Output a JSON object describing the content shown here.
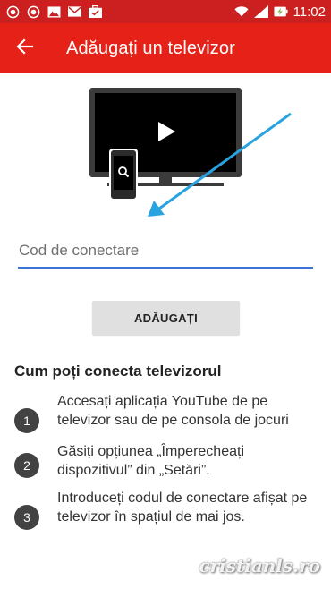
{
  "status_bar": {
    "time": "11:02",
    "icons": [
      "camera-circle-icon",
      "camera-circle-icon",
      "image-icon",
      "mail-icon",
      "briefcase-icon",
      "wifi-icon",
      "signal-icon",
      "battery-charging-icon"
    ]
  },
  "app_bar": {
    "title": "Adăugați un televizor",
    "back_icon": "arrow-left-icon",
    "color": "#e62117"
  },
  "illustration": {
    "description_icons": [
      "tv-icon",
      "play-icon",
      "phone-icon",
      "search-icon",
      "arrow-icon"
    ],
    "arrow_color": "#29a3e0"
  },
  "code_input": {
    "value": "",
    "placeholder": "Cod de conectare"
  },
  "add_button": {
    "label": "ADĂUGAȚI"
  },
  "how_to": {
    "title": "Cum poți conecta televizorul",
    "steps": [
      {
        "number": "1",
        "text": "Accesați aplicația YouTube de pe televizor sau de pe consola de jocuri"
      },
      {
        "number": "2",
        "text": "Găsiți opțiunea „Împerecheați dispozitivul” din „Setări”."
      },
      {
        "number": "3",
        "text": "Introduceți codul de conectare afișat pe televizor în spațiul de mai jos."
      }
    ]
  },
  "watermark": "cristianls.ro"
}
